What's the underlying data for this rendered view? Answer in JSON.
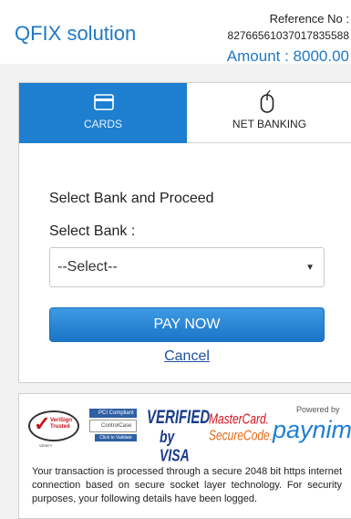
{
  "header": {
    "brand": "QFIX solution",
    "reference_label": "Reference No :",
    "reference_value": "82766561037017835588",
    "amount": "Amount : 8000.00"
  },
  "tabs": [
    {
      "label": "CARDS",
      "icon": "credit-card-icon",
      "active": true
    },
    {
      "label": "NET BANKING",
      "icon": "mouse-icon",
      "active": false
    }
  ],
  "form": {
    "heading": "Select Bank and Proceed",
    "bank_label": "Select Bank :",
    "bank_select_value": "--Select--",
    "pay_button": "PAY NOW",
    "cancel_link": "Cancel"
  },
  "footer": {
    "logos": {
      "verisign_line1": "VeriSign",
      "verisign_line2": "Trusted",
      "verisign_small": "VERIFY",
      "pci_top": "PCI Compliant",
      "pci_mid": "ControlCase",
      "pci_bottom": "Click to Validate",
      "verified_line1": "VERIFIED",
      "verified_line2": "by VISA",
      "mastercard_line1": "MasterCard.",
      "mastercard_line2": "SecureCode.",
      "powered_by": "Powered by",
      "paynimo_main": "paynim",
      "paynimo_end": "o"
    },
    "secure_text": "Your transaction is processed through a secure 2048 bit https internet connection based on secure socket layer technology. For security purposes, your following details have been logged."
  },
  "colors": {
    "brand_blue": "#1f79c4",
    "active_tab": "#1e7fd0",
    "pay_button": "#1a75c7",
    "cancel_link": "#1f4fa3"
  }
}
